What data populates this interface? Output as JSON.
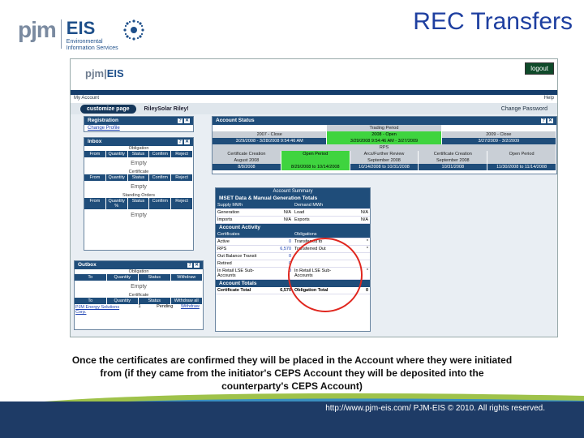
{
  "slide": {
    "title": "REC Transfers",
    "logo_pjm": "pjm",
    "logo_eis": "EIS",
    "logo_sub1": "Environmental",
    "logo_sub2": "Information Services",
    "caption_line1": "Once the certificates are confirmed they will be placed in the Account where they were initiated",
    "caption_line2": "from (if they came from the initiator's CEPS Account they will be deposited into the",
    "caption_line3": "counterparty's CEPS Account)",
    "footer": "http://www.pjm-eis.com/  PJM-EIS © 2010. All rights reserved."
  },
  "app": {
    "logo": "pjm",
    "logo_eis": "EIS",
    "logout": "logout",
    "my_account": "My Account",
    "help": "Help",
    "customize": "customize page",
    "user": "RileySolar  Riley!",
    "change_password": "Change Password"
  },
  "registration": {
    "title": "Registration",
    "link": "Change Profile"
  },
  "inbox": {
    "title": "Inbox",
    "obligation_label": "Obligation",
    "obligation_cols": [
      "From",
      "Quantity",
      "Status",
      "Confirm",
      "Reject"
    ],
    "certificate_label": "Certificate",
    "certificate_cols": [
      "From",
      "Quantity",
      "Status",
      "Confirm",
      "Reject"
    ],
    "standing_label": "Standing Orders",
    "standing_cols": [
      "From",
      "Quantity %",
      "Status",
      "Confirm",
      "Reject"
    ],
    "empty": "Empty"
  },
  "outbox": {
    "title": "Outbox",
    "obligation_label": "Obligation",
    "obligation_cols": [
      "To",
      "Quantity",
      "Status",
      "Withdraw"
    ],
    "certificate_label": "Certificate",
    "certificate_cols": [
      "To",
      "Quantity",
      "Status",
      "Withdraw all"
    ],
    "row": {
      "to": "PJM Energy Solutions Corp.",
      "qty": "1",
      "status": "Pending",
      "action": "Withdraw"
    },
    "empty": "Empty"
  },
  "account_status": {
    "title": "Account Status",
    "trading_period": "Trading Period",
    "periods": [
      "2007 - Close",
      "2008 - Open",
      "2009 - Close"
    ],
    "dates": [
      "3/29/2008 - 3/28/2008 9:54:46 AM",
      "3/29/2008 9:54:46 AM - 3/27/2009",
      "3/27/2009 - 3/2/2009"
    ],
    "rps_label": "RPS",
    "rps_cols": [
      "Certificate Creation",
      "Open Period",
      "Arcs/Further Review",
      "Certificate Creation",
      "Open Period"
    ],
    "rps_sub": [
      "August 2008",
      "",
      "September 2008",
      "September 2008",
      ""
    ],
    "rps_dates": [
      "8/8/2008",
      "8/29/2008 to 10/14/2008",
      "10/14/2008 to 10/31/2008",
      "10/31/2008",
      "11/30/2008 to 11/14/2008"
    ]
  },
  "summary": {
    "title": "Account Summary",
    "section": "MSET Data & Manual Generation Totals",
    "left_head": "Supply MWh",
    "right_head": "Demand MWh",
    "rows": [
      {
        "l": "Generation",
        "lv": "N/A",
        "r": "Load",
        "rv": "N/A"
      },
      {
        "l": "Imports",
        "lv": "N/A",
        "r": "Exports",
        "rv": "N/A"
      }
    ],
    "activity": "Account Activity",
    "cert_head": "Certificates",
    "obl_head": "Obligations",
    "activity_rows": [
      {
        "l": "Active",
        "lv": "0",
        "r": "Transferred to",
        "rv": "*"
      },
      {
        "l": "RPS",
        "lv": "6,570",
        "r": "Transferred Out",
        "rv": "*"
      },
      {
        "l": "Out Balance Transit",
        "lv": "0",
        "r": "",
        "rv": ""
      },
      {
        "l": "Retired",
        "lv": "0",
        "r": "",
        "rv": ""
      },
      {
        "l": "In Retail LSE Sub-Accounts",
        "lv": "0",
        "r": "In Retail LSE Sub-Accounts",
        "rv": "*"
      }
    ],
    "totals": "Account Totals",
    "total_row": {
      "l": "Certificate Total",
      "lv": "6,570",
      "r": "Obligation Total",
      "rv": "0"
    }
  },
  "colors": {
    "navy": "#1f4d7a",
    "green": "#3fd43f",
    "title_blue": "#1e3fa0",
    "circle": "#e0261e"
  }
}
